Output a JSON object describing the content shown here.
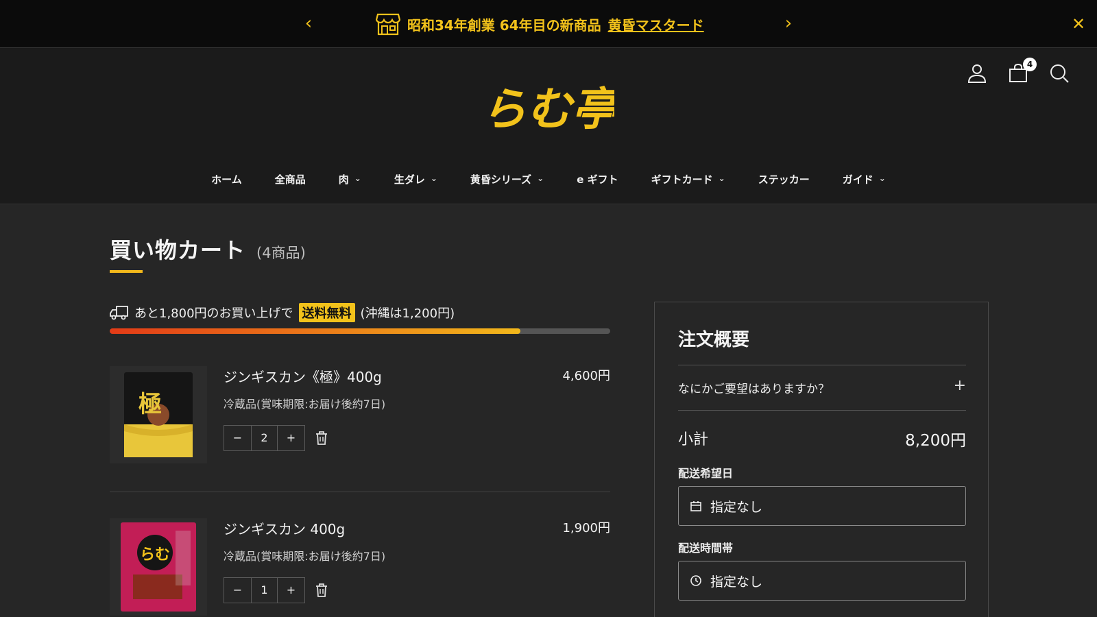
{
  "announcement": {
    "prev_icon": "chevron-left-icon",
    "next_icon": "chevron-right-icon",
    "store_icon": "shop-icon",
    "text": "昭和34年創業 64年目の新商品",
    "link": "黄昏マスタード",
    "close_icon": "close-icon",
    "accent_color": "#f2c21b"
  },
  "header": {
    "logo_text": "らむ亭",
    "icons": [
      "account-icon",
      "cart-icon",
      "search-icon"
    ],
    "cart_count": "4"
  },
  "nav": {
    "items": [
      {
        "label": "ホーム",
        "dropdown": false
      },
      {
        "label": "全商品",
        "dropdown": false
      },
      {
        "label": "肉",
        "dropdown": true
      },
      {
        "label": "生ダレ",
        "dropdown": true
      },
      {
        "label": "黄昏シリーズ",
        "dropdown": true
      },
      {
        "label": "e ギフト",
        "dropdown": false
      },
      {
        "label": "ギフトカード",
        "dropdown": true
      },
      {
        "label": "ステッカー",
        "dropdown": false
      },
      {
        "label": "ガイド",
        "dropdown": true
      }
    ],
    "chevron": "⌄"
  },
  "cart": {
    "title": "買い物カート",
    "count_label": "(4商品)",
    "shipping": {
      "prefix": "あと1,800円のお買い上げで",
      "badge": "送料無料",
      "suffix": "(沖縄は1,200円)",
      "progress_fraction": 0.82
    },
    "items": [
      {
        "name": "ジンギスカン《極》400g",
        "price": "4,600円",
        "note": "冷蔵品(賞味期限:お届け後約7日)",
        "qty": "2",
        "minus": "−",
        "plus": "+"
      },
      {
        "name": "ジンギスカン 400g",
        "price": "1,900円",
        "note": "冷蔵品(賞味期限:お届け後約7日)",
        "qty": "1",
        "minus": "−",
        "plus": "+"
      }
    ]
  },
  "summary": {
    "title": "注文概要",
    "request_label": "なにかご要望はありますか？",
    "request_plus": "+",
    "subtotal_label": "小計",
    "subtotal_value": "8,200円",
    "delivery_date_label": "配送希望日",
    "delivery_date_value": "指定なし",
    "delivery_time_label": "配送時間帯",
    "delivery_time_value": "指定なし"
  }
}
